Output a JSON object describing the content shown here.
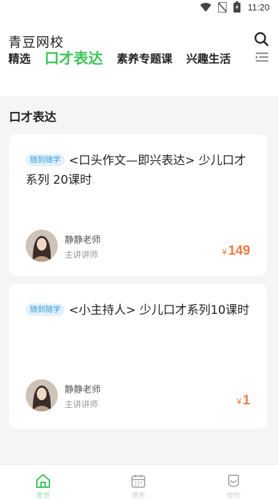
{
  "status_bar": {
    "time": "11:20",
    "icons": [
      "wifi-icon",
      "no-sim-icon",
      "battery-charging-icon"
    ]
  },
  "header": {
    "title": "青豆网校",
    "search_icon": "search-icon",
    "tabs": [
      {
        "label": "精选",
        "active": false
      },
      {
        "label": "口才表达",
        "active": true
      },
      {
        "label": "素养专题课",
        "active": false
      },
      {
        "label": "兴趣生活",
        "active": false
      }
    ],
    "menu_icon": "category-menu-icon"
  },
  "section": {
    "title": "口才表达"
  },
  "courses": [
    {
      "badge": "随到随学",
      "title": "<口头作文—即兴表达> 少儿口才系列 20课时",
      "teacher_name": "静静老师",
      "teacher_role": "主讲讲师",
      "currency": "¥",
      "price": "149"
    },
    {
      "badge": "随到随学",
      "title": "<小主持人> 少儿口才系列10课时",
      "teacher_name": "静静老师",
      "teacher_role": "主讲讲师",
      "currency": "¥",
      "price": "1"
    }
  ],
  "bottom_nav": [
    {
      "label": "首页",
      "icon": "home-icon",
      "active": true
    },
    {
      "label": "课表",
      "icon": "calendar-icon",
      "active": false
    },
    {
      "label": "我的",
      "icon": "profile-icon",
      "active": false
    }
  ],
  "colors": {
    "accent": "#3cc35a",
    "price": "#f07a40",
    "badge_bg": "#e3f1fb",
    "badge_text": "#3aa0e0",
    "background": "#f5f5f5"
  }
}
